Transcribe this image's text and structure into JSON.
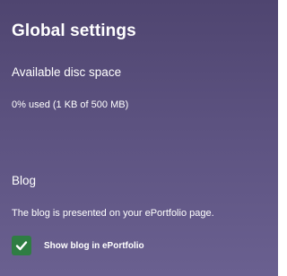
{
  "panel": {
    "title": "Global settings",
    "disc_space": {
      "heading": "Available disc space",
      "usage_text": "0% used (1 KB of 500 MB)"
    },
    "blog": {
      "heading": "Blog",
      "description": "The blog is presented on your ePortfolio page.",
      "show_blog_option": {
        "label": "Show blog in ePortfolio",
        "checked": true,
        "icon": "checkmark-icon"
      }
    }
  },
  "colors": {
    "panel_background": "#5c5280",
    "checkbox_fill": "#2f7d43",
    "text": "#ffffff"
  }
}
